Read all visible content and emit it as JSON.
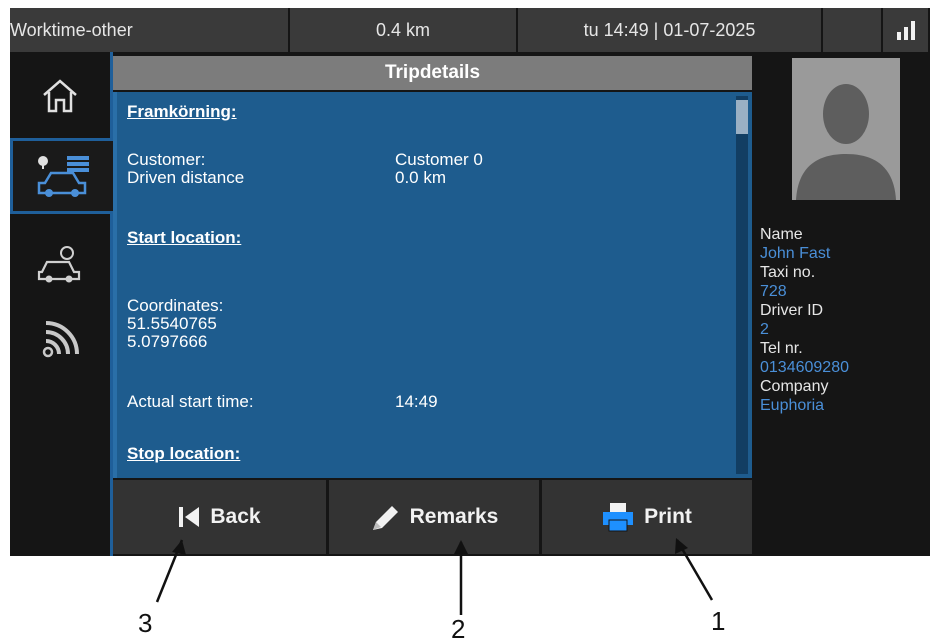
{
  "status_bar": {
    "mode": "Worktime-other",
    "distance": "0.4 km",
    "datetime": "tu 14:49 | 01-07-2025",
    "signal_icon": "signal-bars-icon"
  },
  "sidebar": {
    "items": [
      {
        "icon": "home-icon"
      },
      {
        "icon": "trip-details-icon",
        "active": true
      },
      {
        "icon": "taxi-icon"
      },
      {
        "icon": "wireless-icon"
      }
    ]
  },
  "panel": {
    "title": "Tripdetails",
    "framkorning_heading": "Framkörning:",
    "customer_label": "Customer:",
    "customer_value": "Customer 0",
    "driven_distance_label": "Driven distance",
    "driven_distance_value": "0.0 km",
    "start_location_heading": "Start location:",
    "coordinates_label": "Coordinates:",
    "lat": "51.5540765",
    "lon": "5.0797666",
    "actual_start_time_label": "Actual start time:",
    "actual_start_time_value": "14:49",
    "stop_location_heading": "Stop location:"
  },
  "buttons": {
    "back": "Back",
    "remarks": "Remarks",
    "print": "Print"
  },
  "driver": {
    "name_label": "Name",
    "name_value": "John Fast",
    "taxi_label": "Taxi no.",
    "taxi_value": "728",
    "driver_id_label": "Driver ID",
    "driver_id_value": "2",
    "tel_label": "Tel nr.",
    "tel_value": "0134609280",
    "company_label": "Company",
    "company_value": "Euphoria"
  },
  "callouts": {
    "print": "1",
    "remarks": "2",
    "back": "3"
  },
  "colors": {
    "content_bg": "#1e5c8e",
    "accent_blue": "#4a8fd8",
    "print_icon": "#1e90ff"
  }
}
